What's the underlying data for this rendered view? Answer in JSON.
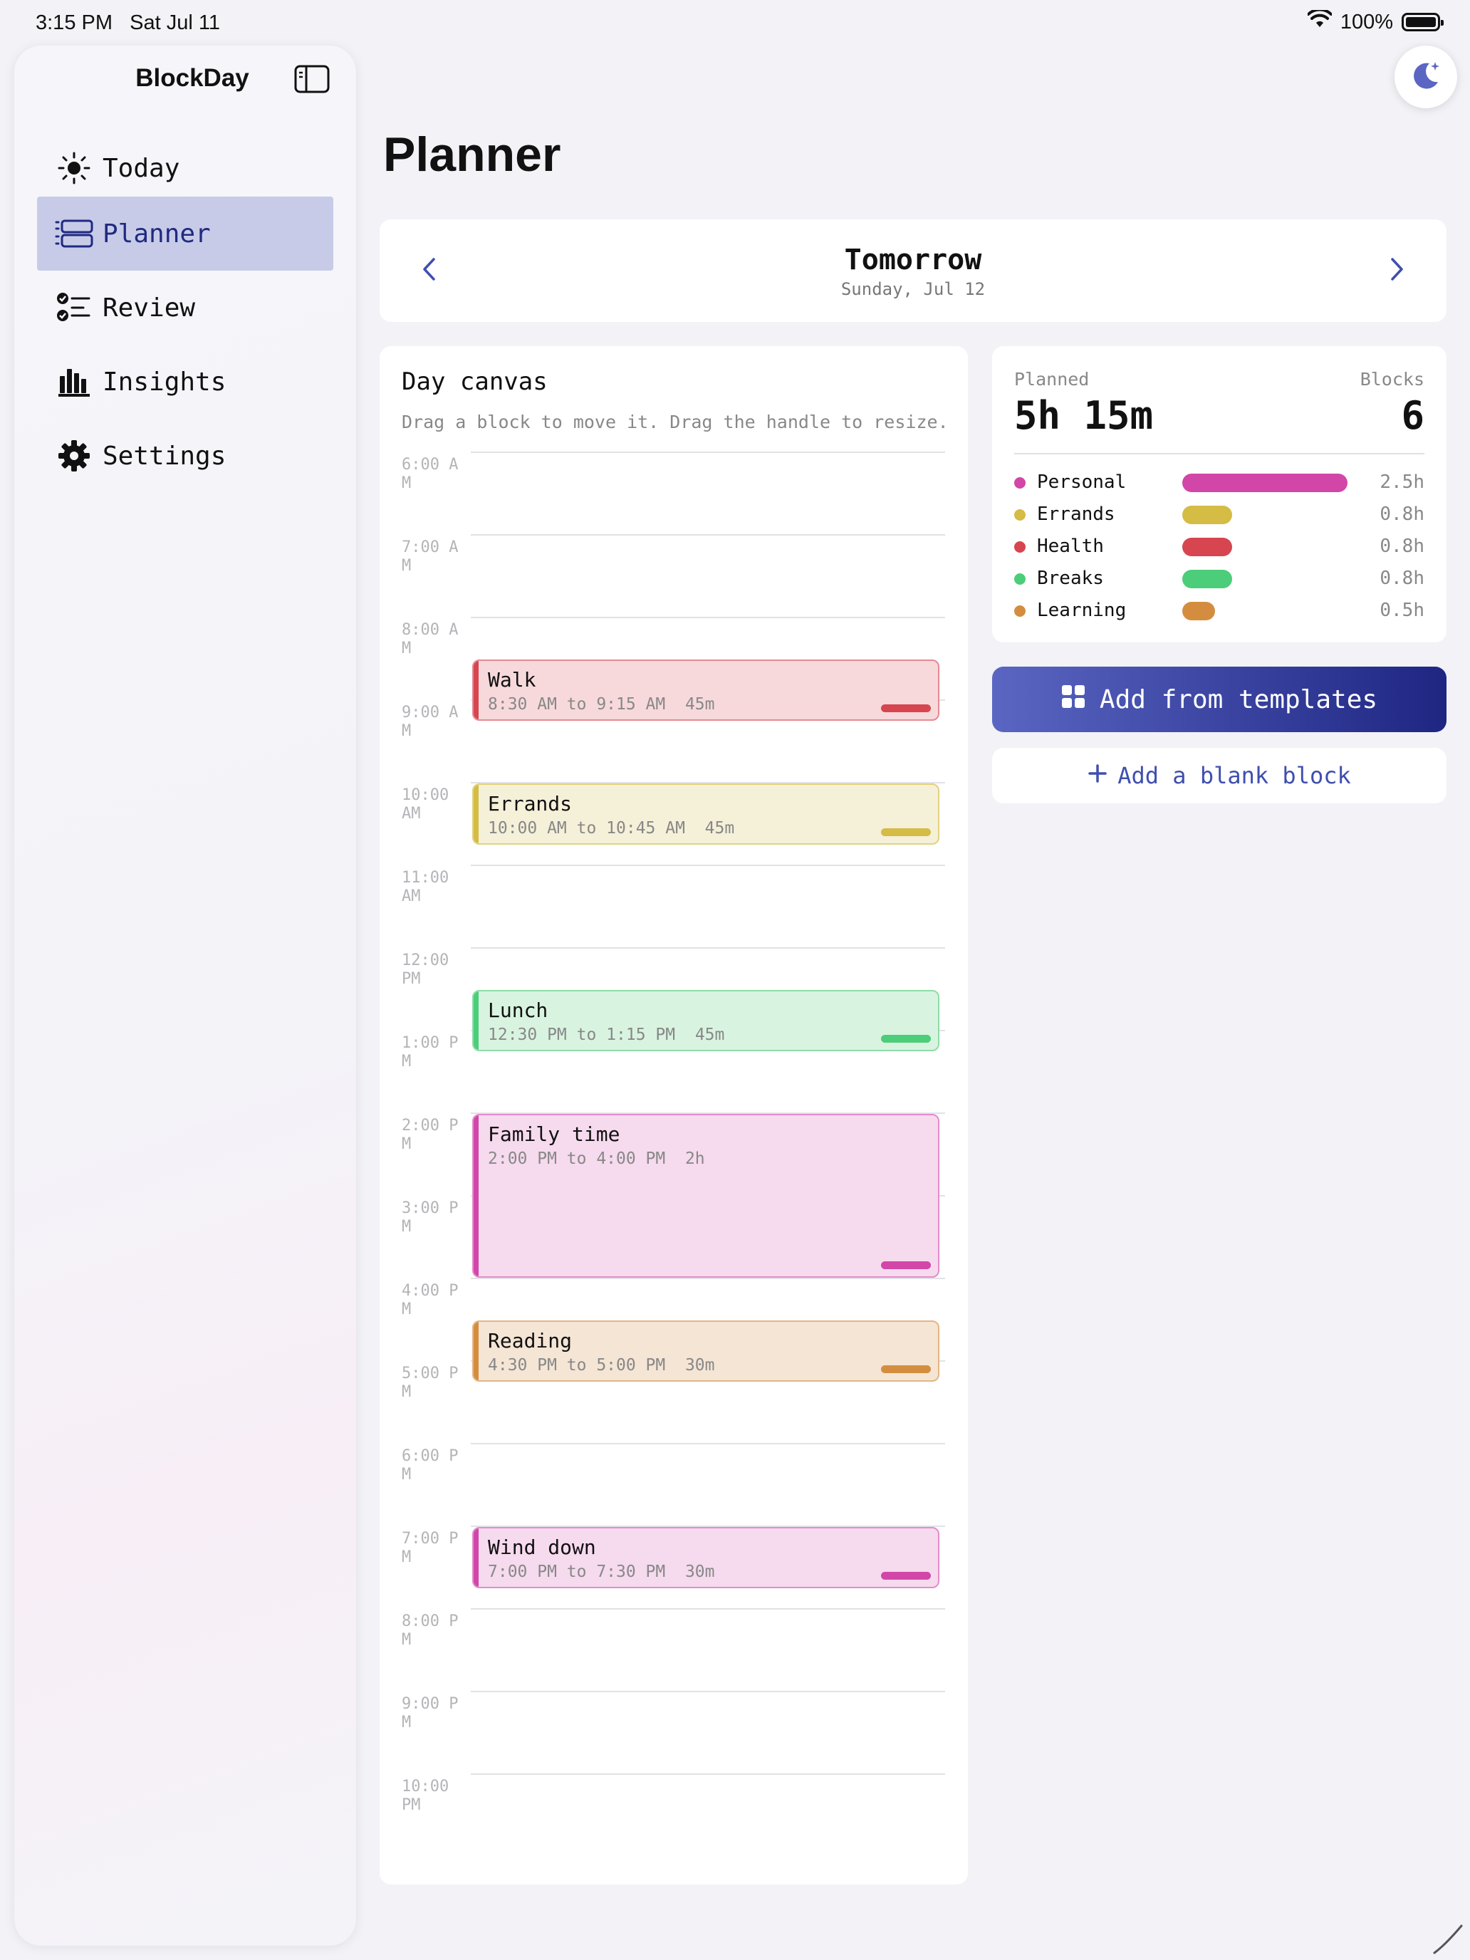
{
  "status_bar": {
    "time": "3:15 PM",
    "date": "Sat Jul 11",
    "battery": "100%"
  },
  "sidebar": {
    "title": "BlockDay",
    "items": [
      {
        "label": "Today",
        "icon": "sun-icon",
        "active": false
      },
      {
        "label": "Planner",
        "icon": "planner-icon",
        "active": true
      },
      {
        "label": "Review",
        "icon": "checklist-icon",
        "active": false
      },
      {
        "label": "Insights",
        "icon": "bar-chart-icon",
        "active": false
      },
      {
        "label": "Settings",
        "icon": "gear-icon",
        "active": false
      }
    ]
  },
  "page": {
    "title": "Planner"
  },
  "date_nav": {
    "title": "Tomorrow",
    "subtitle": "Sunday, Jul 12"
  },
  "canvas": {
    "title": "Day canvas",
    "help": "Drag a block to move it. Drag the handle to resize.",
    "hours": [
      "6:00 AM",
      "7:00 AM",
      "8:00 AM",
      "9:00 AM",
      "10:00 AM",
      "11:00 AM",
      "12:00 PM",
      "1:00 PM",
      "2:00 PM",
      "3:00 PM",
      "4:00 PM",
      "5:00 PM",
      "6:00 PM",
      "7:00 PM",
      "8:00 PM",
      "9:00 PM",
      "10:00 PM"
    ],
    "blocks": [
      {
        "title": "Walk",
        "time": "8:30 AM to 9:15 AM",
        "duration": "45m",
        "category": "Health"
      },
      {
        "title": "Errands",
        "time": "10:00 AM to 10:45 AM",
        "duration": "45m",
        "category": "Errands"
      },
      {
        "title": "Lunch",
        "time": "12:30 PM to 1:15 PM",
        "duration": "45m",
        "category": "Breaks"
      },
      {
        "title": "Family time",
        "time": "2:00 PM to 4:00 PM",
        "duration": "2h",
        "category": "Personal"
      },
      {
        "title": "Reading",
        "time": "4:30 PM to 5:00 PM",
        "duration": "30m",
        "category": "Learning"
      },
      {
        "title": "Wind down",
        "time": "7:00 PM to 7:30 PM",
        "duration": "30m",
        "category": "Personal"
      }
    ]
  },
  "summary": {
    "planned_label": "Planned",
    "planned_value": "5h 15m",
    "blocks_label": "Blocks",
    "blocks_value": "6",
    "categories": [
      {
        "name": "Personal",
        "hours": "2.5h",
        "value": 2.5,
        "color": "#d246a8"
      },
      {
        "name": "Errands",
        "hours": "0.8h",
        "value": 0.75,
        "color": "#d4bc45"
      },
      {
        "name": "Health",
        "hours": "0.8h",
        "value": 0.75,
        "color": "#d64550"
      },
      {
        "name": "Breaks",
        "hours": "0.8h",
        "value": 0.75,
        "color": "#4ccd7a"
      },
      {
        "name": "Learning",
        "hours": "0.5h",
        "value": 0.5,
        "color": "#d48d3f"
      }
    ]
  },
  "actions": {
    "templates": "Add from templates",
    "blank": "Add a blank block"
  },
  "colors": {
    "accent": "#3f4fae",
    "Health": {
      "bg": "#f7d9dc",
      "border": "#e48a93",
      "bar": "#d64550"
    },
    "Errands": {
      "bg": "#f5f0d8",
      "border": "#e2d27e",
      "bar": "#d4bc45"
    },
    "Breaks": {
      "bg": "#d8f4e0",
      "border": "#8fdca8",
      "bar": "#4ccd7a"
    },
    "Personal": {
      "bg": "#f6daee",
      "border": "#e38ccb",
      "bar": "#d246a8"
    },
    "Learning": {
      "bg": "#f5e5d5",
      "border": "#e4b583",
      "bar": "#d48d3f"
    }
  }
}
